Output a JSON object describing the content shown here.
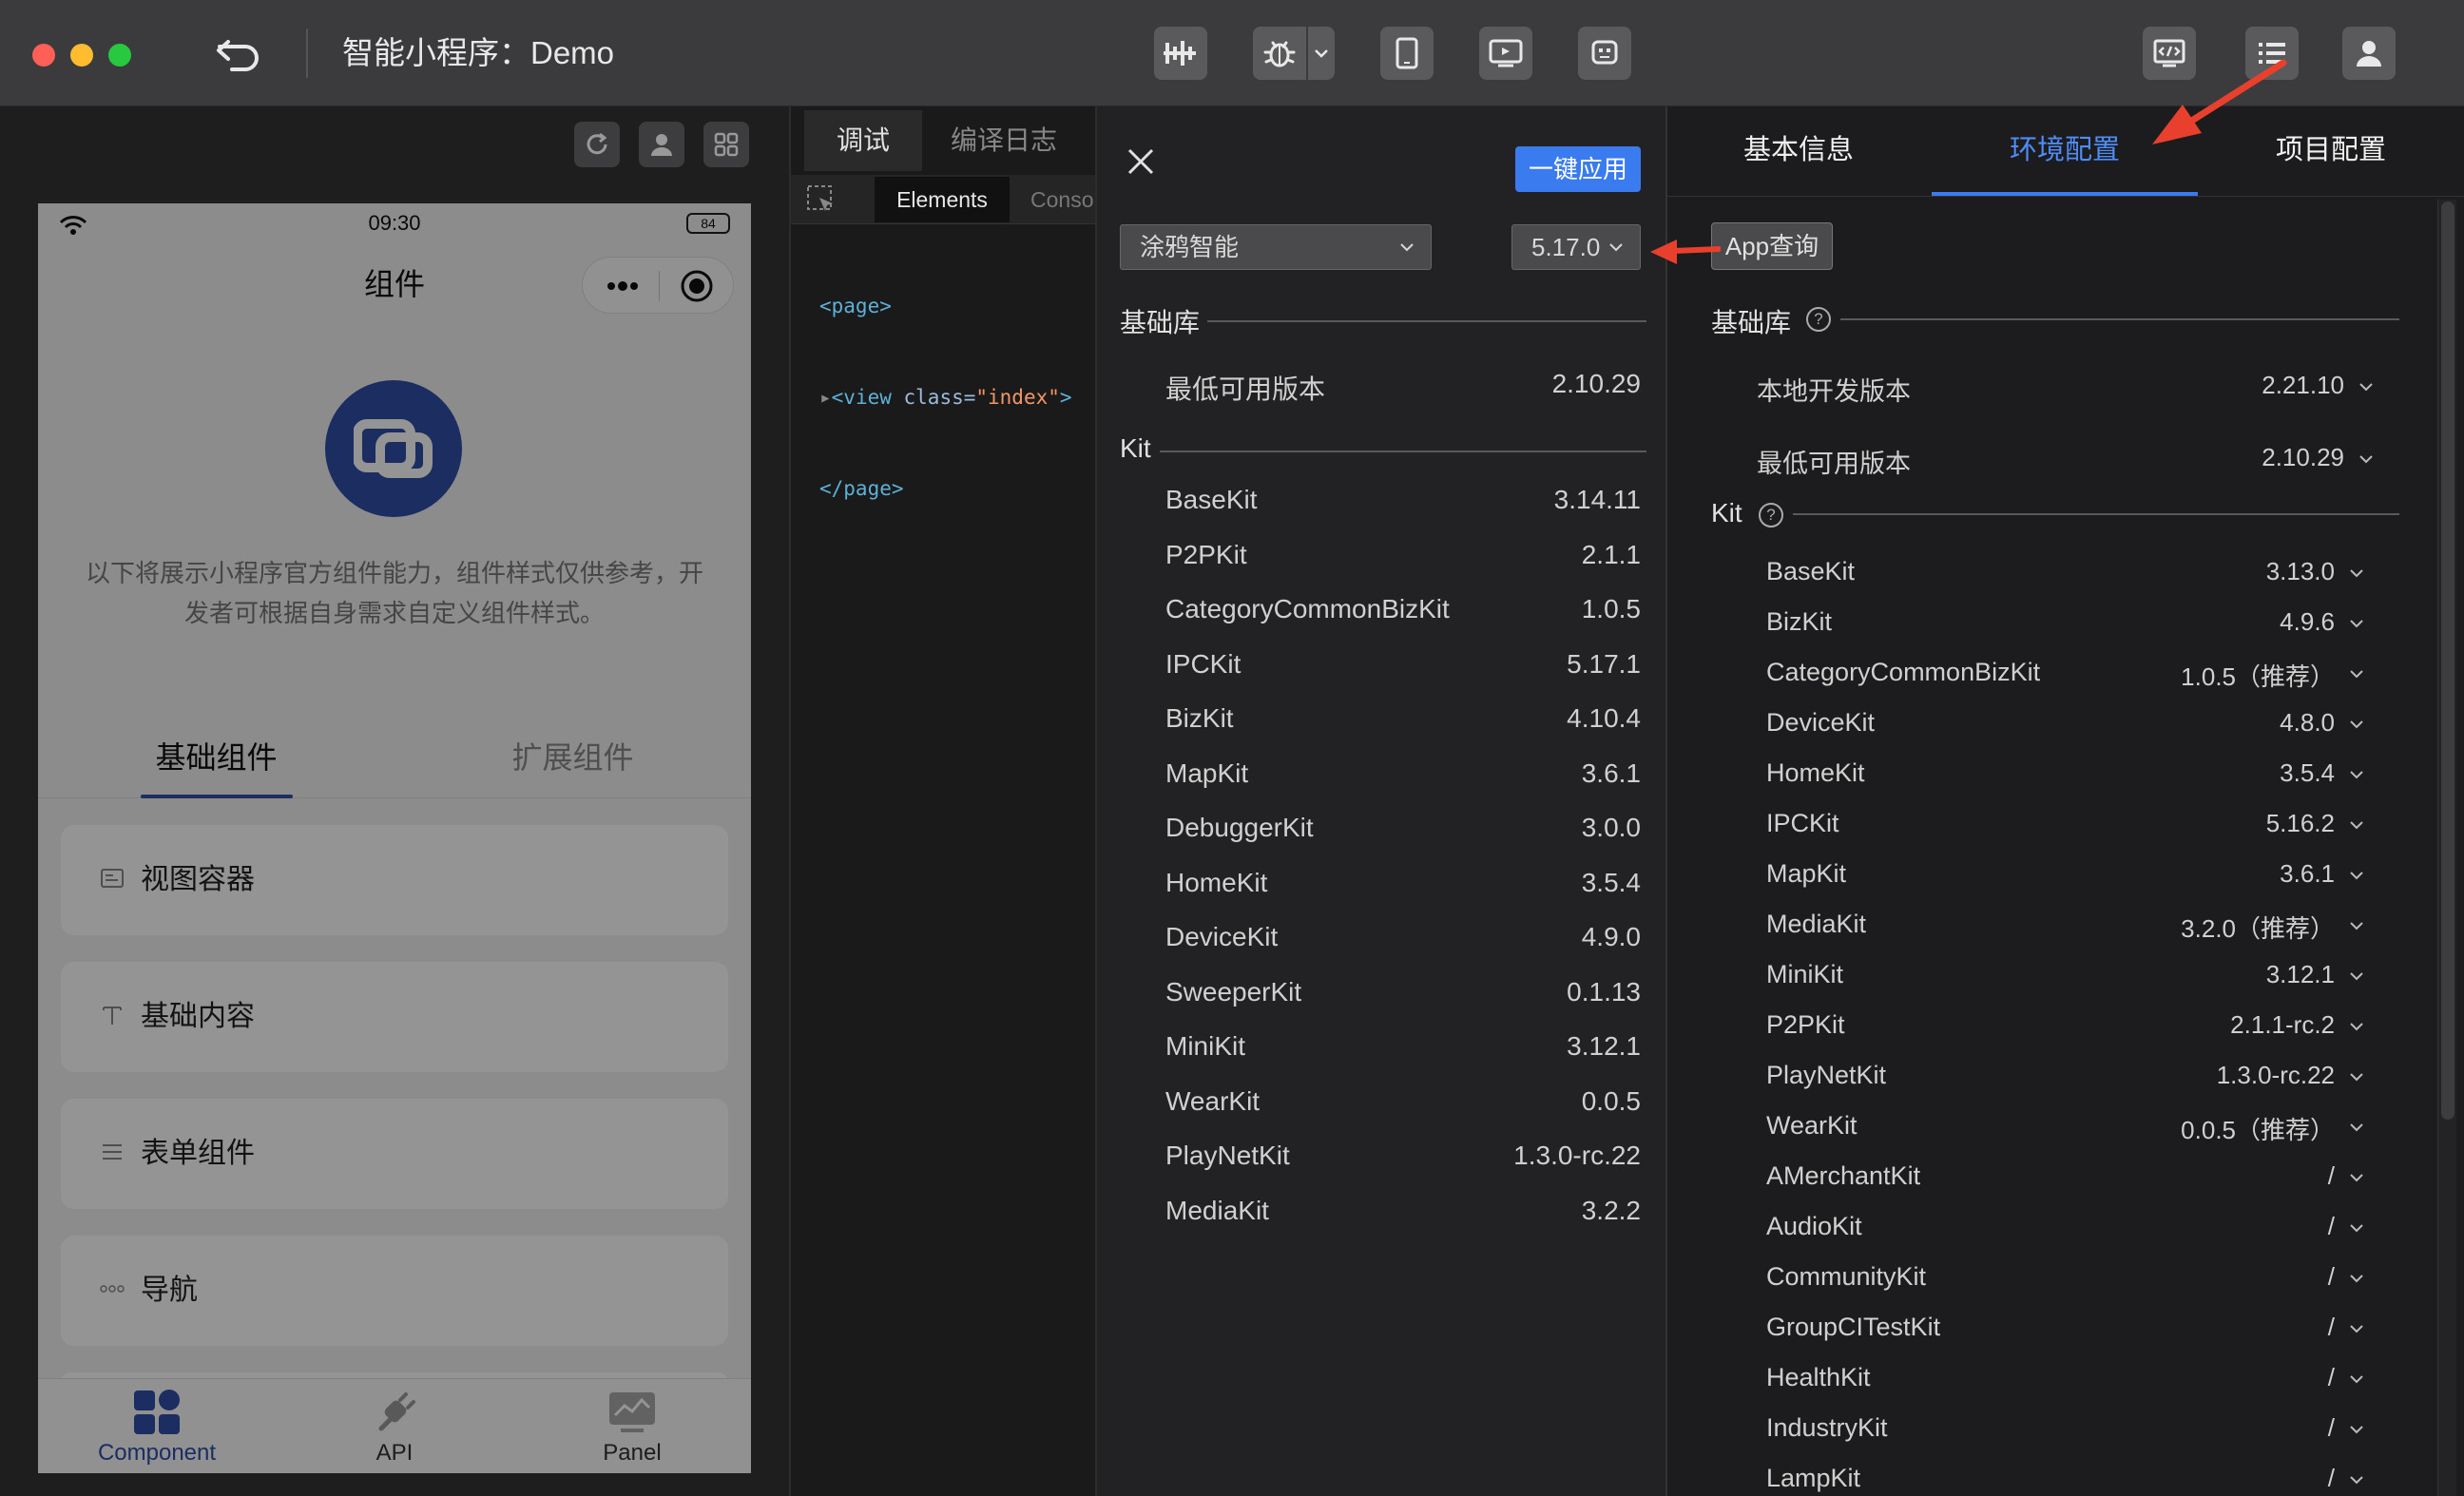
{
  "window": {
    "title": "智能小程序：Demo"
  },
  "simulator": {
    "status_time": "09:30",
    "battery": "84",
    "nav_title": "组件",
    "intro_line1": "以下将展示小程序官方组件能力，组件样式仅供参考，开",
    "intro_line2": "发者可根据自身需求自定义组件样式。",
    "tabs": [
      "基础组件",
      "扩展组件"
    ],
    "cards": [
      "视图容器",
      "基础内容",
      "表单组件",
      "导航"
    ],
    "tabbar": [
      "Component",
      "API",
      "Panel"
    ]
  },
  "debugger": {
    "tabs": [
      "调试",
      "编译日志"
    ],
    "subtabs": [
      "Elements",
      "Conso"
    ],
    "code": {
      "line1_tag": "<page>",
      "line2_open": "<view ",
      "line2_attr": "class=",
      "line2_val": "\"index\"",
      "line2_close": ">",
      "line3_tag": "</page>"
    }
  },
  "middle": {
    "apply_label": "一键应用",
    "platform_select": "涂鸦智能",
    "version_select": "5.17.0",
    "base_section": "基础库",
    "base_rows": [
      {
        "name": "最低可用版本",
        "value": "2.10.29"
      }
    ],
    "kit_section": "Kit",
    "kits": [
      {
        "name": "BaseKit",
        "value": "3.14.11"
      },
      {
        "name": "P2PKit",
        "value": "2.1.1"
      },
      {
        "name": "CategoryCommonBizKit",
        "value": "1.0.5"
      },
      {
        "name": "IPCKit",
        "value": "5.17.1"
      },
      {
        "name": "BizKit",
        "value": "4.10.4"
      },
      {
        "name": "MapKit",
        "value": "3.6.1"
      },
      {
        "name": "DebuggerKit",
        "value": "3.0.0"
      },
      {
        "name": "HomeKit",
        "value": "3.5.4"
      },
      {
        "name": "DeviceKit",
        "value": "4.9.0"
      },
      {
        "name": "SweeperKit",
        "value": "0.1.13"
      },
      {
        "name": "MiniKit",
        "value": "3.12.1"
      },
      {
        "name": "WearKit",
        "value": "0.0.5"
      },
      {
        "name": "PlayNetKit",
        "value": "1.3.0-rc.22"
      },
      {
        "name": "MediaKit",
        "value": "3.2.2"
      }
    ]
  },
  "right": {
    "tabs": [
      "基本信息",
      "环境配置",
      "项目配置"
    ],
    "app_query": "App查询",
    "base_section": "基础库",
    "base_rows": [
      {
        "name": "本地开发版本",
        "value": "2.21.10"
      },
      {
        "name": "最低可用版本",
        "value": "2.10.29"
      }
    ],
    "kit_section": "Kit",
    "kits": [
      {
        "name": "BaseKit",
        "value": "3.13.0"
      },
      {
        "name": "BizKit",
        "value": "4.9.6"
      },
      {
        "name": "CategoryCommonBizKit",
        "value": "1.0.5（推荐）"
      },
      {
        "name": "DeviceKit",
        "value": "4.8.0"
      },
      {
        "name": "HomeKit",
        "value": "3.5.4"
      },
      {
        "name": "IPCKit",
        "value": "5.16.2"
      },
      {
        "name": "MapKit",
        "value": "3.6.1"
      },
      {
        "name": "MediaKit",
        "value": "3.2.0（推荐）"
      },
      {
        "name": "MiniKit",
        "value": "3.12.1"
      },
      {
        "name": "P2PKit",
        "value": "2.1.1-rc.2"
      },
      {
        "name": "PlayNetKit",
        "value": "1.3.0-rc.22"
      },
      {
        "name": "WearKit",
        "value": "0.0.5（推荐）"
      },
      {
        "name": "AMerchantKit",
        "value": "/"
      },
      {
        "name": "AudioKit",
        "value": "/"
      },
      {
        "name": "CommunityKit",
        "value": "/"
      },
      {
        "name": "GroupCITestKit",
        "value": "/"
      },
      {
        "name": "HealthKit",
        "value": "/"
      },
      {
        "name": "IndustryKit",
        "value": "/"
      },
      {
        "name": "LampKit",
        "value": "/"
      }
    ]
  },
  "colors": {
    "accent": "#3a7bf0",
    "annotation_arrow": "#e8402c",
    "brand_blue": "#2f4fa8"
  }
}
